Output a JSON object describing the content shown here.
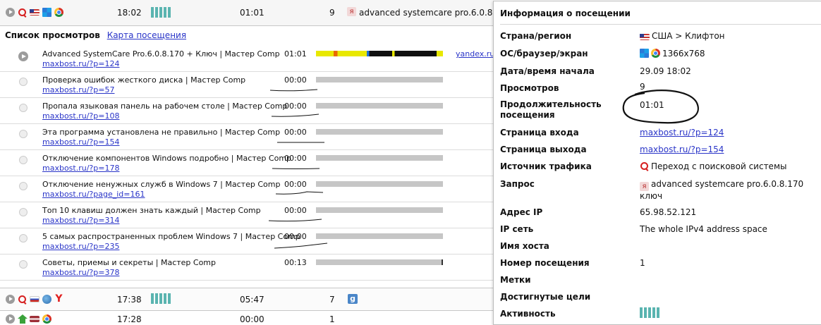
{
  "visits": [
    {
      "time": "18:02",
      "duration": "01:01",
      "pages": "9",
      "query": "advanced systemcare pro.6.0.8.170",
      "icons": [
        "play-icon",
        "search-icon",
        "flag-us-icon",
        "windows-icon",
        "chrome-icon"
      ]
    },
    {
      "time": "17:38",
      "duration": "05:47",
      "pages": "7",
      "ref_icon": "g",
      "icons": [
        "play-icon",
        "search-icon",
        "flag-ru-icon",
        "globe-icon",
        "yandex-browser-icon"
      ]
    },
    {
      "time": "17:28",
      "duration": "00:00",
      "pages": "1",
      "icons": [
        "play-icon",
        "house-icon",
        "flag-lv-icon",
        "chrome-icon"
      ]
    }
  ],
  "views_panel": {
    "title": "Список просмотров",
    "map_link": "Карта посещения"
  },
  "views": [
    {
      "title": "Advanced SystemCare Pro.6.0.8.170 + Ключ | Мастер Comp",
      "url": "maxbost.ru/?p=124",
      "time": "01:01",
      "referrer": "yandex.ru/",
      "progress": 1.0
    },
    {
      "title": "Проверка ошибок жесткого диска | Мастер Comp",
      "url": "maxbost.ru/?p=57",
      "time": "00:00",
      "progress": 1.0
    },
    {
      "title": "Пропала языковая панель на рабочем столе | Мастер Comp",
      "url": "maxbost.ru/?p=108",
      "time": "00:00",
      "progress": 1.0
    },
    {
      "title": "Эта программа установлена не правильно | Мастер Comp",
      "url": "maxbost.ru/?p=154",
      "time": "00:00",
      "progress": 1.0
    },
    {
      "title": "Отключение компонентов Windows подробно | Мастер Comp",
      "url": "maxbost.ru/?p=178",
      "time": "00:00",
      "progress": 1.0
    },
    {
      "title": "Отключение ненужных служб в Windows 7 | Мастер Comp",
      "url": "maxbost.ru/?page_id=161",
      "time": "00:00",
      "progress": 1.0
    },
    {
      "title": "Топ 10 клавиш должен знать каждый | Мастер Comp",
      "url": "maxbost.ru/?p=314",
      "time": "00:00",
      "progress": 1.0
    },
    {
      "title": "5 самых распространенных проблем Windows 7 | Мастер Comp",
      "url": "maxbost.ru/?p=235",
      "time": "00:00",
      "progress": 1.0
    },
    {
      "title": "Советы, приемы и секреты | Мастер Comp",
      "url": "maxbost.ru/?p=378",
      "time": "00:13",
      "progress": 1.0
    }
  ],
  "info": {
    "title": "Информация о посещении",
    "rows": {
      "country_label": "Страна/регион",
      "country_value": "США > Клифтон",
      "os_label": "ОС/браузер/экран",
      "os_value": "1366x768",
      "start_label": "Дата/время начала",
      "start_value": "29.09 18:02",
      "views_label": "Просмотров",
      "views_value": "9",
      "duration_label_1": "Продолжительность",
      "duration_label_2": "посещения",
      "duration_value": "01:01",
      "entry_label": "Страница входа",
      "entry_value": "maxbost.ru/?p=124",
      "exit_label": "Страница выхода",
      "exit_value": "maxbost.ru/?p=154",
      "source_label": "Источник трафика",
      "source_value": "Переход с поисковой системы",
      "query_label": "Запрос",
      "query_value_1": "advanced systemcare pro.6.0.8.170",
      "query_value_2": "ключ",
      "ip_label": "Адрес IP",
      "ip_value": "65.98.52.121",
      "net_label": "IP сеть",
      "net_value": "The whole IPv4 address space",
      "host_label": "Имя хоста",
      "visit_no_label": "Номер посещения",
      "visit_no_value": "1",
      "tags_label": "Метки",
      "goals_label": "Достигнутые цели",
      "activity_label": "Активность"
    }
  },
  "colors": {
    "activity": "#5ab4b0",
    "link": "#2a35c8",
    "bar_gray": "#c6c6c6"
  }
}
